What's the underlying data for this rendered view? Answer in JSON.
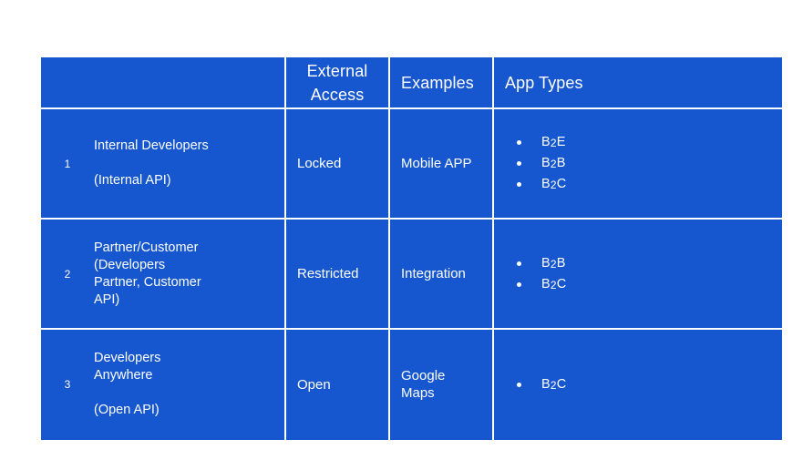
{
  "table": {
    "accent_color": "#1657cf",
    "text_color": "#ffffff",
    "divider_color": "#ffffff",
    "headers": {
      "description": "",
      "external_access": "External\nAccess",
      "examples": "Examples",
      "app_types": "App Types"
    },
    "rows": [
      {
        "number": "1",
        "description": "Internal Developers\n\n(Internal API)",
        "external_access": "Locked",
        "examples": "Mobile APP",
        "app_types": [
          "B2E",
          "B2B",
          "B2C"
        ]
      },
      {
        "number": "2",
        "description": "Partner/Customer\n(Developers\nPartner, Customer\nAPI)",
        "external_access": "Restricted",
        "examples": "Integration",
        "app_types": [
          "B2B",
          "B2C"
        ]
      },
      {
        "number": "3",
        "description": "Developers\nAnywhere\n\n(Open API)",
        "external_access": "Open",
        "examples": "Google\nMaps",
        "app_types": [
          "B2C"
        ]
      }
    ]
  }
}
